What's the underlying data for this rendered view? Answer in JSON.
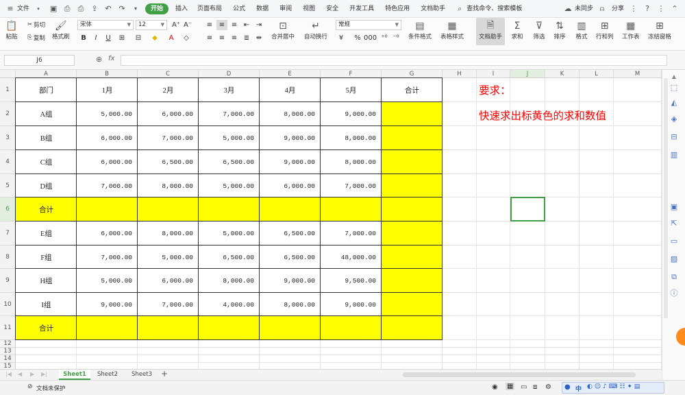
{
  "menubar": {
    "file_label": "文件",
    "tabs": [
      "开始",
      "插入",
      "页面布局",
      "公式",
      "数据",
      "审阅",
      "视图",
      "安全",
      "开发工具",
      "特色应用",
      "文档助手"
    ],
    "search_label": "查找命令、搜索模板",
    "sync_label": "未同步",
    "share_label": "分享"
  },
  "ribbon": {
    "paste_label": "粘贴",
    "cut_label": "剪切",
    "copy_label": "复制",
    "format_painter_label": "格式刷",
    "font_name": "宋体",
    "font_size": "12",
    "merge_center_label": "合并居中",
    "wrap_label": "自动换行",
    "number_format": "常规",
    "cond_format_label": "条件格式",
    "table_style_label": "表格样式",
    "doc_assist_label": "文档助手",
    "sum_label": "求和",
    "filter_label": "筛选",
    "sort_label": "排序",
    "format_label": "格式",
    "rowcol_label": "行和列",
    "sheet_label": "工作表",
    "freeze_label": "冻结窗格"
  },
  "formula_bar": {
    "cell_ref": "J6",
    "fx": "fx",
    "formula": ""
  },
  "columns": [
    "A",
    "B",
    "C",
    "D",
    "E",
    "F",
    "G",
    "H",
    "I",
    "J",
    "K",
    "L",
    "M"
  ],
  "rows": [
    "1",
    "2",
    "3",
    "4",
    "5",
    "6",
    "7",
    "8",
    "9",
    "10",
    "11",
    "12",
    "13",
    "14",
    "15"
  ],
  "table": {
    "header": [
      "部门",
      "1月",
      "2月",
      "3月",
      "4月",
      "5月",
      "合计"
    ],
    "rows": [
      [
        "A组",
        "5,000.00",
        "6,000.00",
        "7,000.00",
        "8,000.00",
        "9,000.00",
        ""
      ],
      [
        "B组",
        "6,000.00",
        "7,000.00",
        "5,000.00",
        "9,000.00",
        "8,000.00",
        ""
      ],
      [
        "C组",
        "6,000.00",
        "6,500.00",
        "6,500.00",
        "9,000.00",
        "8,000.00",
        ""
      ],
      [
        "D组",
        "7,000.00",
        "8,000.00",
        "5,000.00",
        "6,000.00",
        "7,000.00",
        ""
      ],
      [
        "合计",
        "",
        "",
        "",
        "",
        "",
        ""
      ],
      [
        "E组",
        "6,000.00",
        "8,000.00",
        "5,000.00",
        "6,500.00",
        "7,000.00",
        ""
      ],
      [
        "F组",
        "7,000.00",
        "5,000.00",
        "6,500.00",
        "6,500.00",
        "48,000.00",
        ""
      ],
      [
        "H组",
        "5,000.00",
        "6,000.00",
        "8,000.00",
        "9,000.00",
        "9,500.00",
        ""
      ],
      [
        "I组",
        "9,000.00",
        "7,000.00",
        "4,000.00",
        "8,000.00",
        "9,000.00",
        ""
      ],
      [
        "合计",
        "",
        "",
        "",
        "",
        "",
        ""
      ]
    ]
  },
  "note": {
    "title": "要求：",
    "body": "快速求出标黄色的求和数值"
  },
  "sheets": [
    "Sheet1",
    "Sheet2",
    "Sheet3"
  ],
  "status": {
    "protect_label": "文档未保护",
    "ime_label": "中"
  },
  "colors": {
    "accent": "#3fa045",
    "highlight": "#ffff00",
    "note": "#ff0000"
  }
}
